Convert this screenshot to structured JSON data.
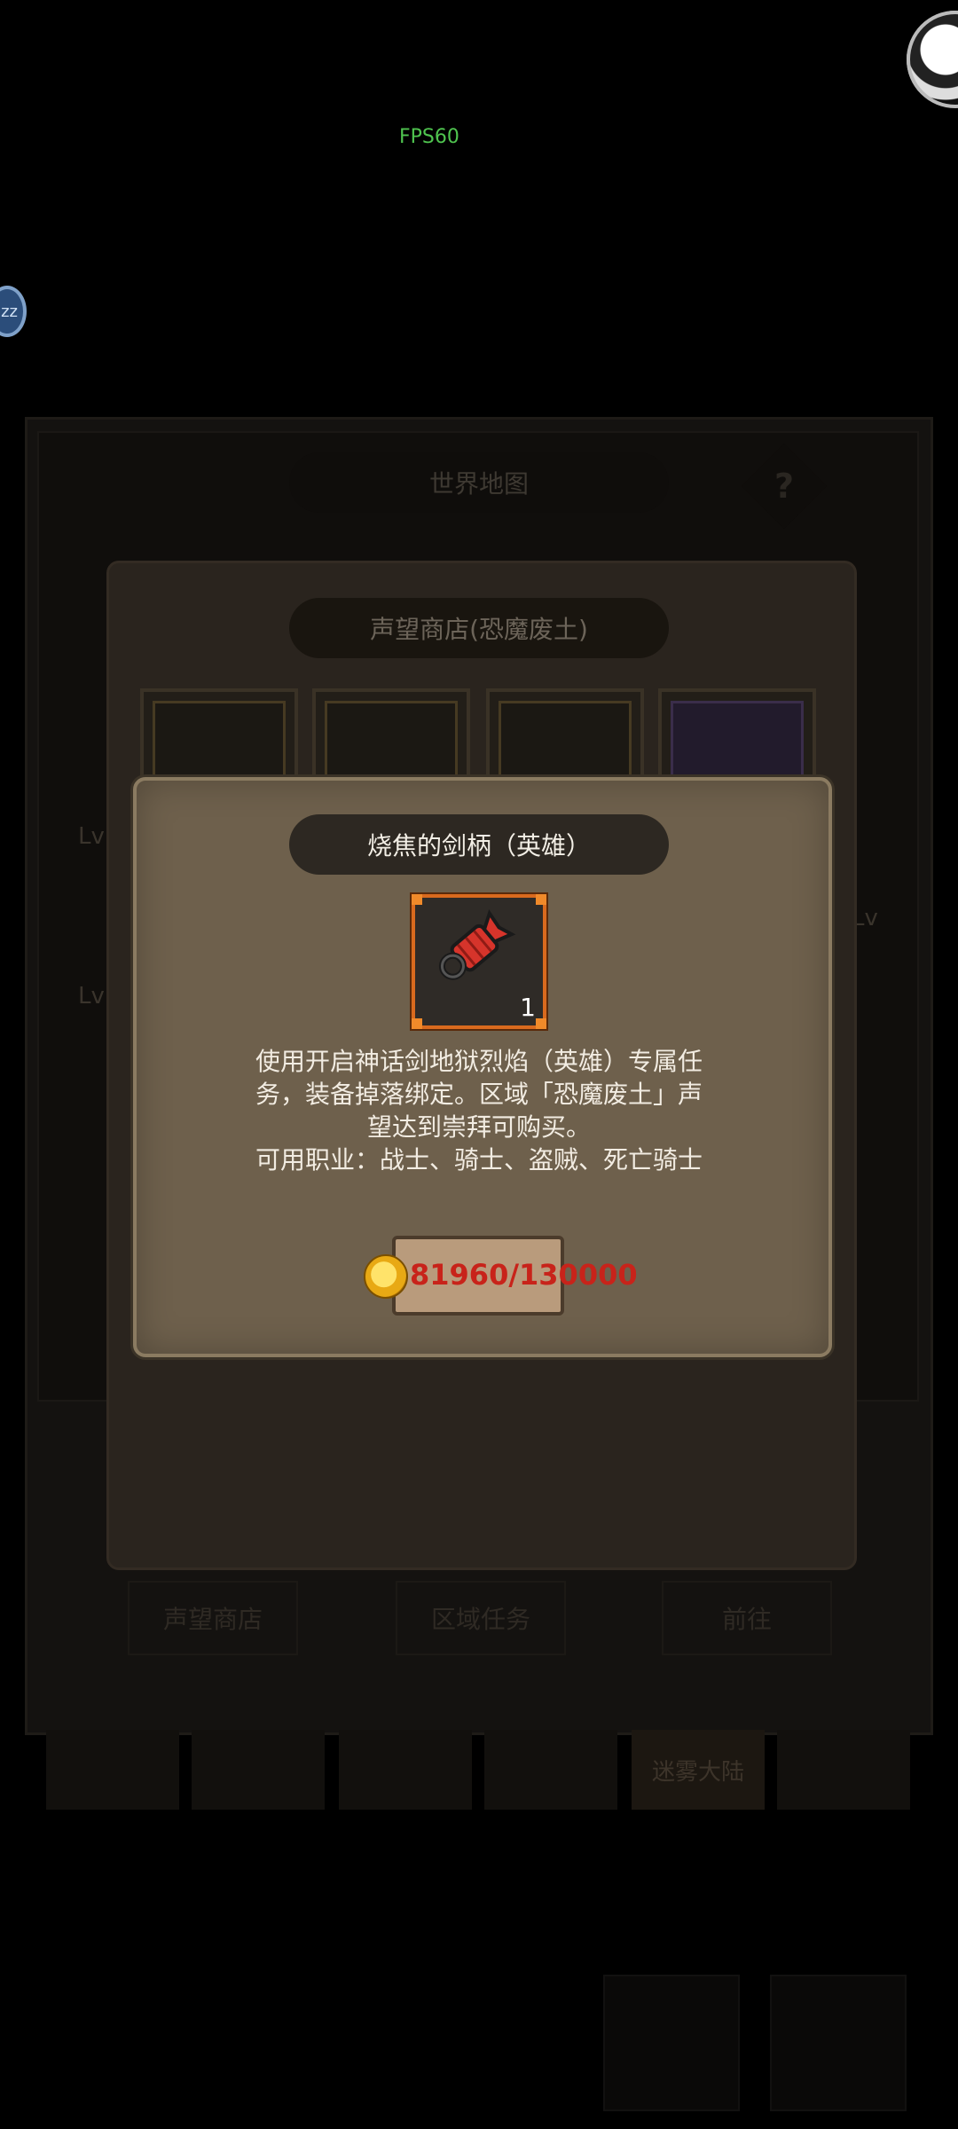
{
  "hud": {
    "fps": "FPS60",
    "badge": "zz"
  },
  "background": {
    "world_map_title": "世界地图",
    "help_symbol": "?",
    "shop_title": "声望商店(恐魔废土)",
    "side_labels": [
      "Lv",
      "Lv",
      "Lv"
    ],
    "bottom_buttons": [
      "声望商店",
      "区域任务",
      "前往"
    ],
    "region_tabs": [
      "",
      "",
      "",
      "",
      "迷雾大陆",
      ""
    ]
  },
  "dialog": {
    "title": "烧焦的剑柄（英雄）",
    "item": {
      "name": "burnt-sword-hilt",
      "count": "1",
      "frame_color": "#d96a1e"
    },
    "description_lines": [
      "使用开启神话剑地狱烈焰（英雄）专属任",
      "务，装备掉落绑定。区域「恐魔废土」声",
      "望达到崇拜可购买。",
      "可用职业：战士、骑士、盗贼、死亡骑士"
    ],
    "price": {
      "text": "81960/130000",
      "color": "#c8231a",
      "currency_icon": "gold-coin-icon"
    }
  }
}
